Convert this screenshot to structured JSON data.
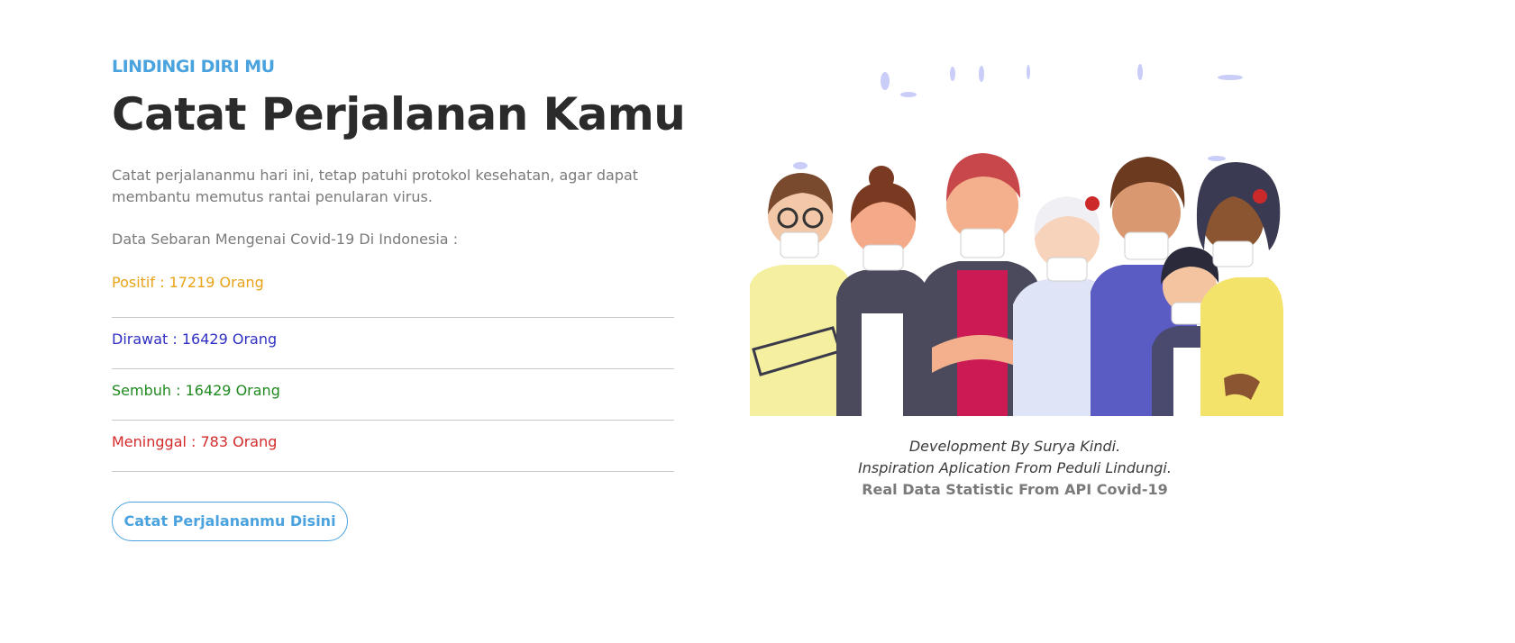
{
  "hero": {
    "kicker": "LINDINGI DIRI MU",
    "title": "Catat Perjalanan Kamu",
    "description": "Catat perjalananmu hari ini, tetap patuhi protokol kesehatan, agar dapat membantu memutus rantai penularan virus.",
    "stats_heading": "Data Sebaran Mengenai Covid-19 Di Indonesia :",
    "stats": [
      {
        "label": "Positif : 17219 Orang",
        "color": "#e8a317"
      },
      {
        "label": "Dirawat : 16429 Orang",
        "color": "#2f2fc4"
      },
      {
        "label": "Sembuh : 16429 Orang",
        "color": "#1f8a1f"
      },
      {
        "label": "Meninggal : 783 Orang",
        "color": "#d42a2a"
      }
    ],
    "cta_label": "Catat Perjalananmu Disini"
  },
  "illustration": {
    "icon": "people-wearing-masks-illustration"
  },
  "credits": {
    "line1": "Development By Surya Kindi.",
    "line2": "Inspiration Aplication From Peduli Lindungi.",
    "line3": "Real Data Statistic From API Covid-19"
  },
  "colors": {
    "accent": "#4aa3df",
    "title": "#2b2b2b",
    "text": "#7a7a7a"
  }
}
